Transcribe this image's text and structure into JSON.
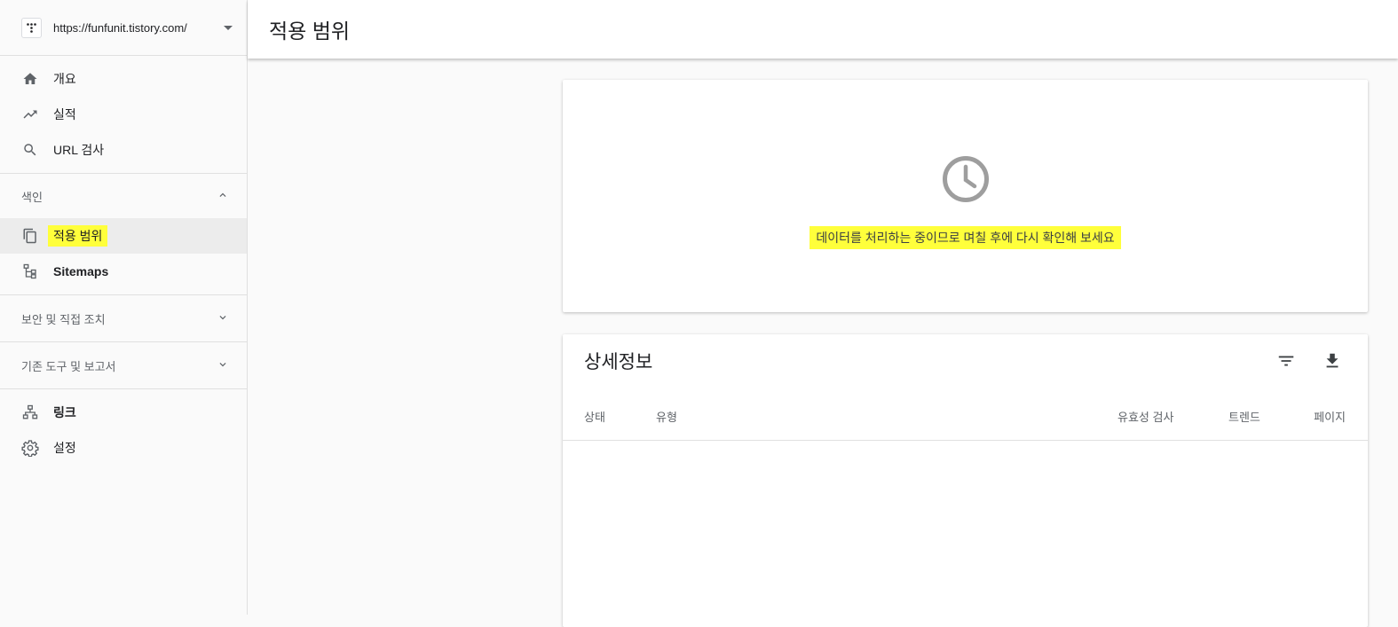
{
  "property": {
    "url": "https://funfunit.tistory.com/"
  },
  "nav_top": [
    {
      "label": "개요",
      "icon": "home-icon"
    },
    {
      "label": "실적",
      "icon": "trending-up-icon"
    },
    {
      "label": "URL 검사",
      "icon": "search-icon"
    }
  ],
  "index_section": {
    "title": "색인",
    "items": [
      {
        "label": "적용 범위",
        "icon": "coverage-icon",
        "active": true
      },
      {
        "label": "Sitemaps",
        "icon": "sitemap-icon"
      }
    ]
  },
  "security_section": {
    "title": "보안 및 직접 조치"
  },
  "legacy_section": {
    "title": "기존 도구 및 보고서"
  },
  "nav_bottom": [
    {
      "label": "링크",
      "icon": "links-icon"
    },
    {
      "label": "설정",
      "icon": "settings-icon"
    }
  ],
  "header": {
    "title": "적용 범위"
  },
  "status_card": {
    "icon": "clock-icon",
    "message": "데이터를 처리하는 중이므로 며칠 후에 다시 확인해 보세요"
  },
  "details": {
    "title": "상세정보",
    "columns": {
      "status": "상태",
      "type": "유형",
      "validation": "유효성 검사",
      "trend": "트렌드",
      "pages": "페이지"
    }
  },
  "colors": {
    "highlight": "#ffff3b",
    "active_bg": "#ececec",
    "icon_gray": "#5f6368"
  }
}
